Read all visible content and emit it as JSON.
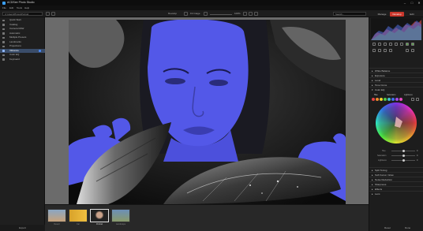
{
  "window": {
    "title": "ACDSee Photo Studio",
    "controls": [
      "–",
      "□",
      "✕"
    ]
  },
  "menu": [
    "File",
    "Edit",
    "Tools",
    "Help"
  ],
  "toolbar": {
    "path": "C:\\Users\\Photos\\Portrait",
    "view_label": "Develop",
    "fit_label": "Fit Image",
    "zoom": "100%",
    "right_search": "Search...",
    "tabs": [
      "Manage",
      "Develop",
      "Edit"
    ]
  },
  "sidebar": {
    "items": [
      {
        "label": "Quick Start",
        "selected": false
      },
      {
        "label": "Catalog",
        "selected": false
      },
      {
        "label": "Camera RAW",
        "selected": false
      },
      {
        "label": "Automatic",
        "selected": false
      },
      {
        "label": "Multiple Presets",
        "selected": false
      },
      {
        "label": "Landmarks",
        "selected": false
      },
      {
        "label": "Projections",
        "selected": false
      },
      {
        "label": "Vibrance",
        "selected": true
      },
      {
        "label": "Color EQ",
        "selected": false
      },
      {
        "label": "Keyboard",
        "selected": false
      }
    ],
    "footer": "Export"
  },
  "filmstrip": [
    {
      "label": "Desert"
    },
    {
      "label": "Car"
    },
    {
      "label": "Portrait",
      "selected": true
    },
    {
      "label": "Landscape"
    }
  ],
  "right_panel": {
    "sections_top": [
      "White Balance",
      "Exposure",
      "Level",
      "Tone Curve",
      "Color EQ"
    ],
    "color_swatches": [
      "#e64343",
      "#f08a2c",
      "#f0d22c",
      "#4fc64a",
      "#3fc0c7",
      "#3f6ef0",
      "#a34be6",
      "#e64ac1"
    ],
    "color_tabs": [
      "Hue",
      "Saturation",
      "Lightness"
    ],
    "sliders": [
      {
        "label": "Hue",
        "value": "0"
      },
      {
        "label": "Saturation",
        "value": "0"
      },
      {
        "label": "Lightness",
        "value": "0"
      }
    ],
    "sections_bottom": [
      "Split Toning",
      "Soft Focus / Glow",
      "Noise Reduction",
      "Sharpness",
      "Effects",
      "Lens"
    ],
    "buttons": [
      "Reset",
      "Done"
    ]
  },
  "colors": {
    "accent": "#4a8cff",
    "selection": "#3a4d6a",
    "photo_blue": "#5358e8"
  }
}
